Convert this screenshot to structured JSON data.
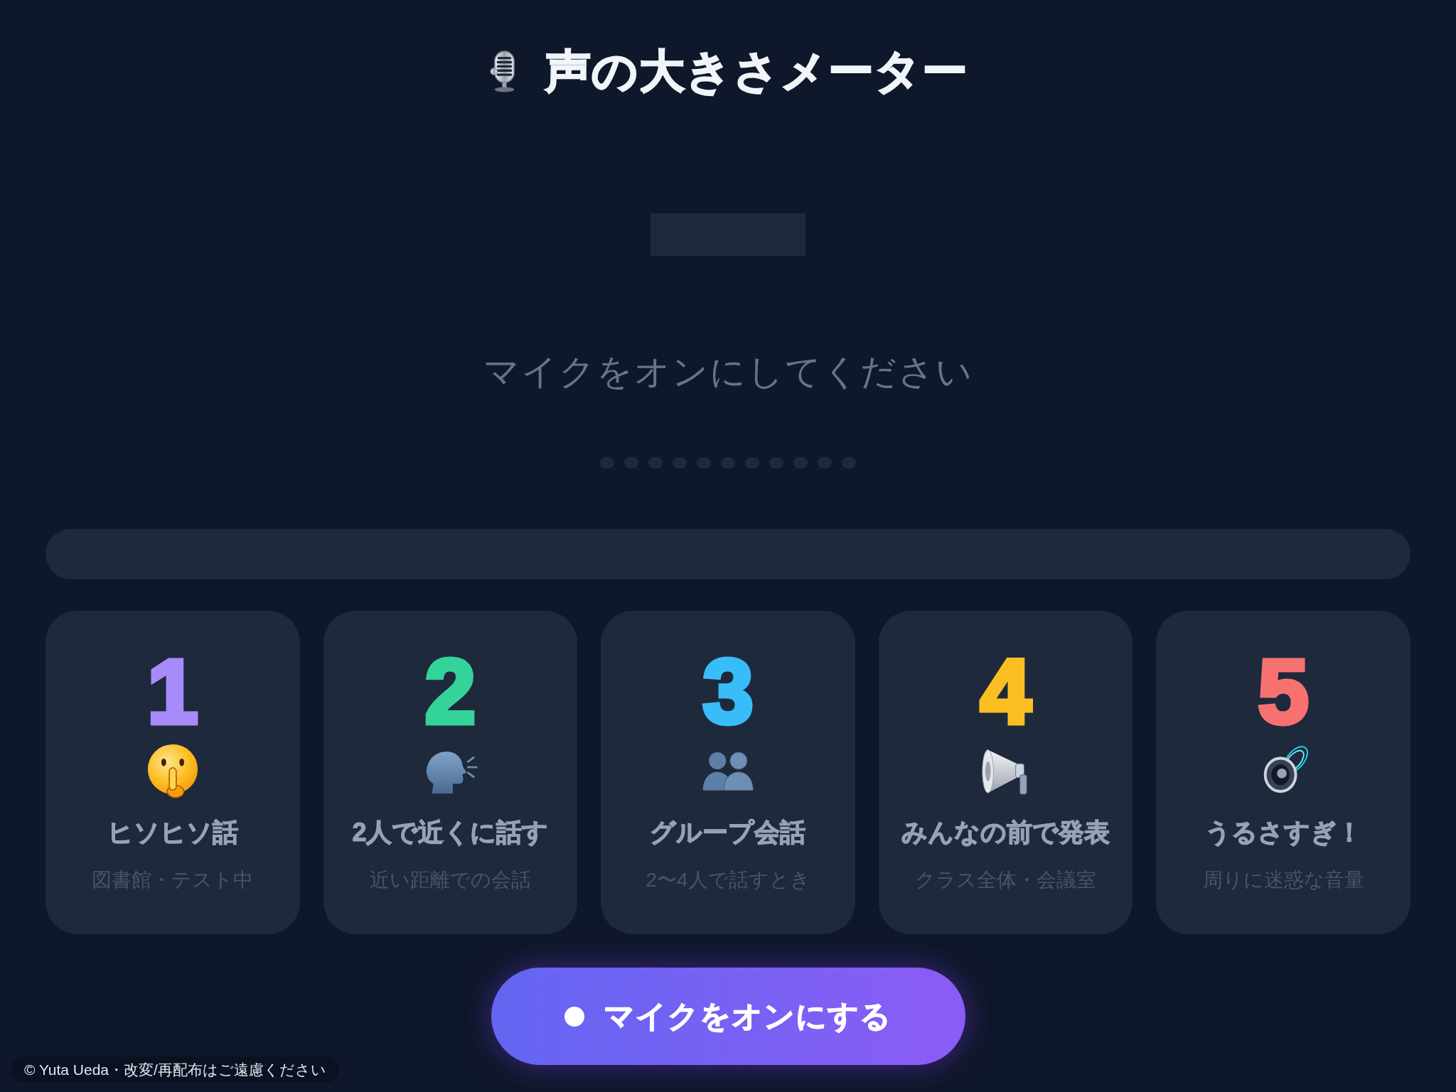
{
  "header": {
    "title": "声の大きさメーター"
  },
  "status_message": "マイクをオンにしてください",
  "level_dots": [
    {
      "on": false
    },
    {
      "on": false
    },
    {
      "on": false
    },
    {
      "on": false
    },
    {
      "on": false
    },
    {
      "on": false
    },
    {
      "on": false
    },
    {
      "on": false
    },
    {
      "on": false
    },
    {
      "on": false
    },
    {
      "on": false
    }
  ],
  "level_bar": {
    "level": 0
  },
  "levels": [
    {
      "number": "1",
      "color": "#a78bfa",
      "title": "ヒソヒソ話",
      "description": "図書館・テスト中"
    },
    {
      "number": "2",
      "color": "#34d399",
      "title": "2人で近くに話す",
      "description": "近い距離での会話"
    },
    {
      "number": "3",
      "color": "#38bdf8",
      "title": "グループ会話",
      "description": "2〜4人で話すとき"
    },
    {
      "number": "4",
      "color": "#fbbf24",
      "title": "みんなの前で発表",
      "description": "クラス全体・会議室"
    },
    {
      "number": "5",
      "color": "#f87171",
      "title": "うるさすぎ！",
      "description": "周りに迷惑な音量"
    }
  ],
  "start_button": {
    "label": "マイクをオンにする"
  },
  "credit": "© Yuta Ueda・改変/再配布はご遠慮ください"
}
